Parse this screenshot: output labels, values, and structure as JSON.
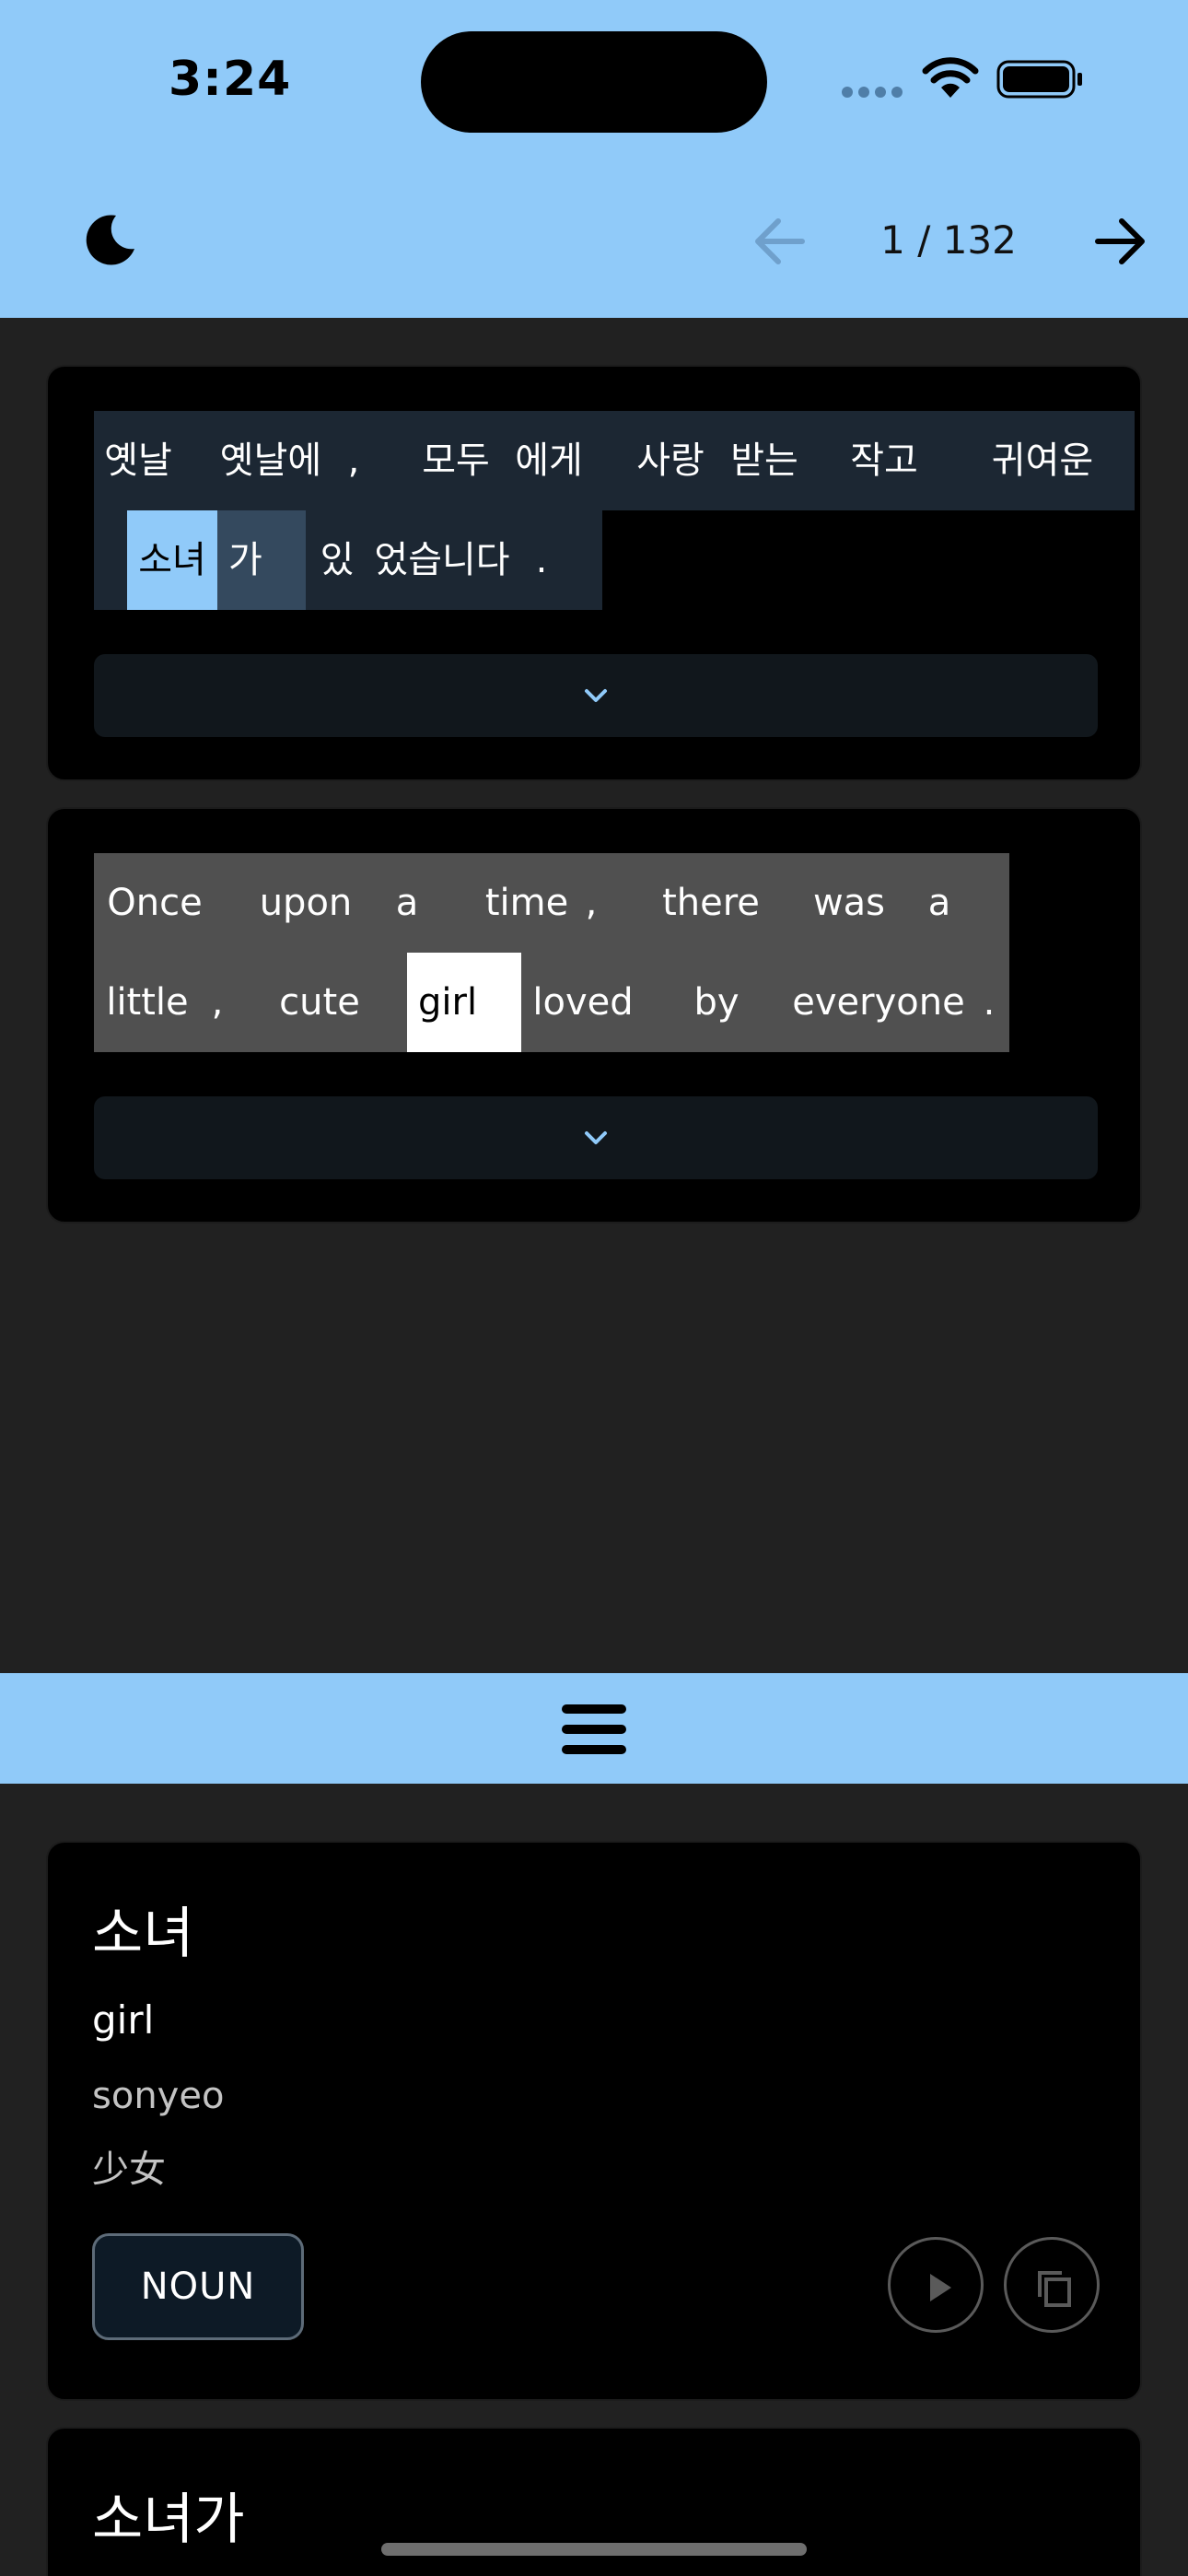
{
  "status_bar": {
    "time": "3:24"
  },
  "header": {
    "theme_toggle_icon": "moon-icon",
    "back_icon": "arrow-left-icon",
    "forward_icon": "arrow-right-icon",
    "page_counter": "1 / 132"
  },
  "korean_sentence": {
    "tokens": [
      "옛날",
      "옛날에",
      ",",
      "모두",
      "에게",
      "사랑",
      "받는",
      "작고",
      "귀여운",
      "소녀",
      "가",
      "있",
      "었습니다",
      "."
    ],
    "selected_token": "소녀"
  },
  "english_sentence": {
    "tokens": [
      "Once",
      "upon",
      "a",
      "time",
      ",",
      "there",
      "was",
      "a",
      "little",
      ",",
      "cute",
      "girl",
      "loved",
      "by",
      "everyone",
      "."
    ],
    "selected_token": "girl"
  },
  "dictionary": {
    "entries": [
      {
        "word": "소녀",
        "meaning": "girl",
        "romanization": "sonyeo",
        "hanja": "少女",
        "part_of_speech": "NOUN"
      },
      {
        "word": "소녀가"
      }
    ]
  },
  "colors": {
    "accent": "#90caf9",
    "background": "#212121",
    "card": "#000000",
    "korean_token_bg": "#1c2733",
    "english_token_bg": "#505050"
  }
}
